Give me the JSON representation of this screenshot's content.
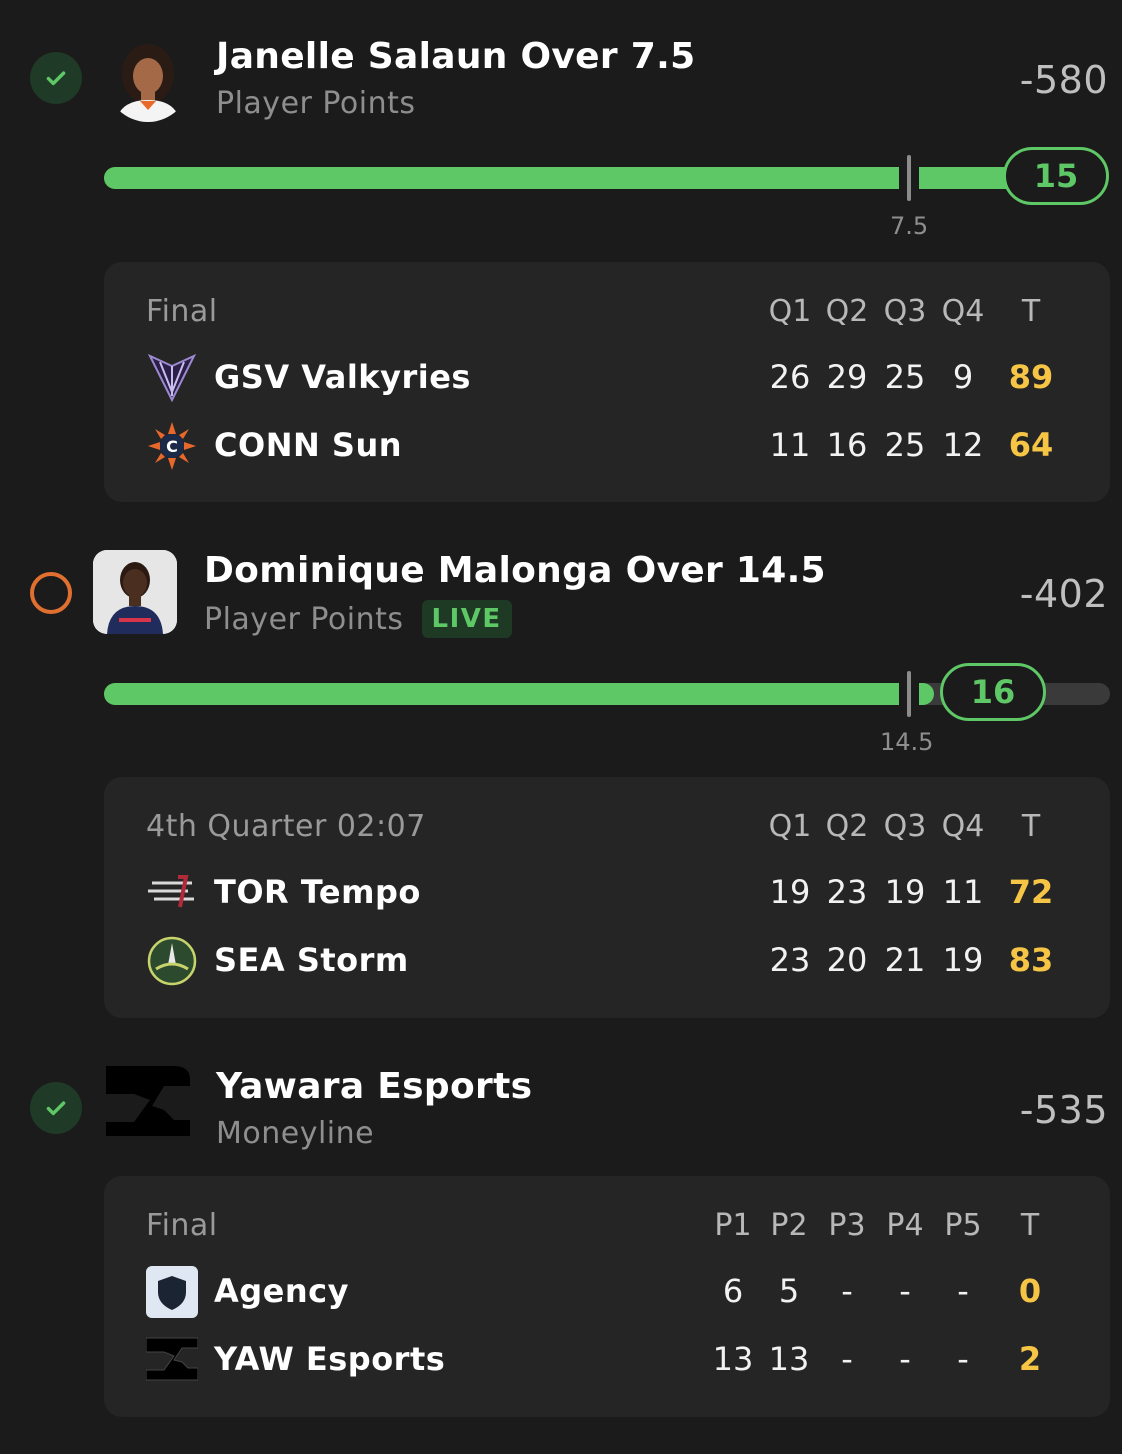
{
  "legs": [
    {
      "title": "Janelle Salaun Over 7.5",
      "subtitle": "Player Points",
      "odds": "-580",
      "status_icon": "check-circle-icon",
      "progress": {
        "line": "7.5",
        "current": "15",
        "fraction": 1.0
      },
      "score": {
        "state": "Final",
        "columns": [
          "Q1",
          "Q2",
          "Q3",
          "Q4",
          "T"
        ],
        "teams": [
          {
            "name": "GSV Valkyries",
            "logo": "valkyries-logo-icon",
            "scores": [
              "26",
              "29",
              "25",
              "9",
              "89"
            ]
          },
          {
            "name": "CONN Sun",
            "logo": "sun-logo-icon",
            "scores": [
              "11",
              "16",
              "25",
              "12",
              "64"
            ]
          }
        ]
      }
    },
    {
      "title": "Dominique Malonga Over 14.5",
      "subtitle": "Player Points",
      "badge": "LIVE",
      "odds": "-402",
      "status_icon": "pending-circle-icon",
      "progress": {
        "line": "14.5",
        "current": "16",
        "fraction": 0.82
      },
      "score": {
        "state": "4th Quarter 02:07",
        "columns": [
          "Q1",
          "Q2",
          "Q3",
          "Q4",
          "T"
        ],
        "teams": [
          {
            "name": "TOR Tempo",
            "logo": "tempo-logo-icon",
            "scores": [
              "19",
              "23",
              "19",
              "11",
              "72"
            ]
          },
          {
            "name": "SEA Storm",
            "logo": "storm-logo-icon",
            "scores": [
              "23",
              "20",
              "21",
              "19",
              "83"
            ]
          }
        ]
      }
    },
    {
      "title": "Yawara Esports",
      "subtitle": "Moneyline",
      "odds": "-535",
      "status_icon": "check-circle-icon",
      "score": {
        "state": "Final",
        "columns": [
          "P1",
          "P2",
          "P3",
          "P4",
          "P5",
          "T"
        ],
        "teams": [
          {
            "name": "Agency",
            "logo": "agency-shield-logo-icon",
            "scores": [
              "6",
              "5",
              "-",
              "-",
              "-",
              "0"
            ]
          },
          {
            "name": "YAW Esports",
            "logo": "yawara-logo-icon",
            "scores": [
              "13",
              "13",
              "-",
              "-",
              "-",
              "2"
            ]
          }
        ]
      }
    }
  ],
  "colors": {
    "accent": "#5ec766",
    "total": "#f6c546",
    "pending": "#e0702f",
    "background": "#1b1b1b",
    "card": "#252525"
  }
}
